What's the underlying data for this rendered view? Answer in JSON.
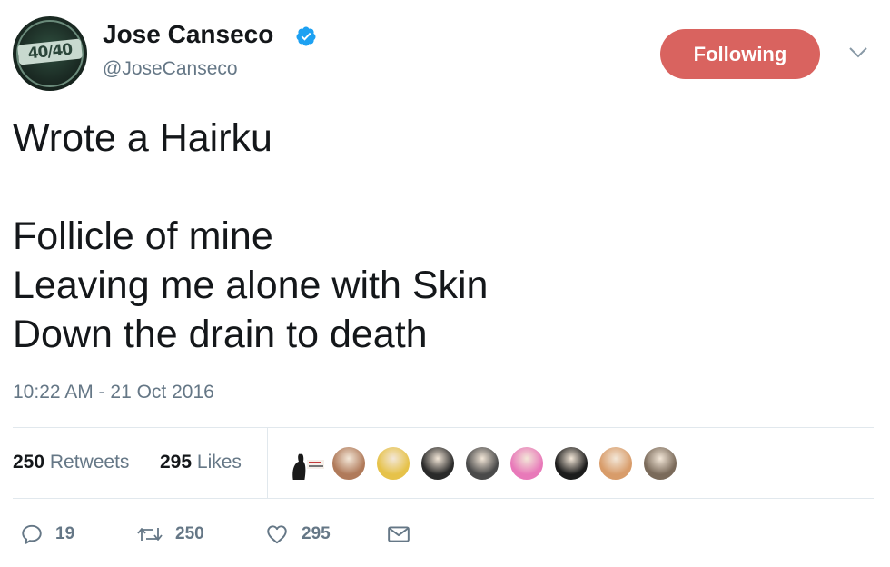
{
  "user": {
    "display_name": "Jose Canseco",
    "handle": "@JoseCanseco",
    "avatar_text": "40/40",
    "verified": true,
    "follow_label": "Following"
  },
  "tweet": {
    "text": "Wrote a Hairku\n\nFollicle of mine\nLeaving me alone with Skin\nDown the drain to death",
    "timestamp": "10:22 AM - 21 Oct 2016"
  },
  "stats": {
    "retweets_count": "250",
    "retweets_label": "Retweets",
    "likes_count": "295",
    "likes_label": "Likes"
  },
  "likers": [
    {
      "name": "liker-cat-avatar",
      "color": "#1a1a1a"
    },
    {
      "name": "liker-avatar-2",
      "color": "#b07a5a"
    },
    {
      "name": "liker-avatar-3",
      "color": "#e6c24a"
    },
    {
      "name": "liker-avatar-4",
      "color": "#2a2a2a"
    },
    {
      "name": "liker-avatar-5",
      "color": "#4a4a4a"
    },
    {
      "name": "liker-avatar-6",
      "color": "#e879b9"
    },
    {
      "name": "liker-avatar-7",
      "color": "#1c1c1c"
    },
    {
      "name": "liker-avatar-8",
      "color": "#d89c6a"
    },
    {
      "name": "liker-avatar-9",
      "color": "#7a6a5a"
    }
  ],
  "actions": {
    "reply_count": "19",
    "retweet_count": "250",
    "like_count": "295"
  },
  "colors": {
    "following_button": "#d9635f",
    "verified": "#1da1f2",
    "muted_text": "#657786",
    "divider": "#e1e8ed"
  },
  "icons": {
    "verified": "verified-badge-icon",
    "caret": "chevron-down-icon",
    "reply": "reply-icon",
    "retweet": "retweet-icon",
    "like": "heart-icon",
    "message": "envelope-icon"
  }
}
